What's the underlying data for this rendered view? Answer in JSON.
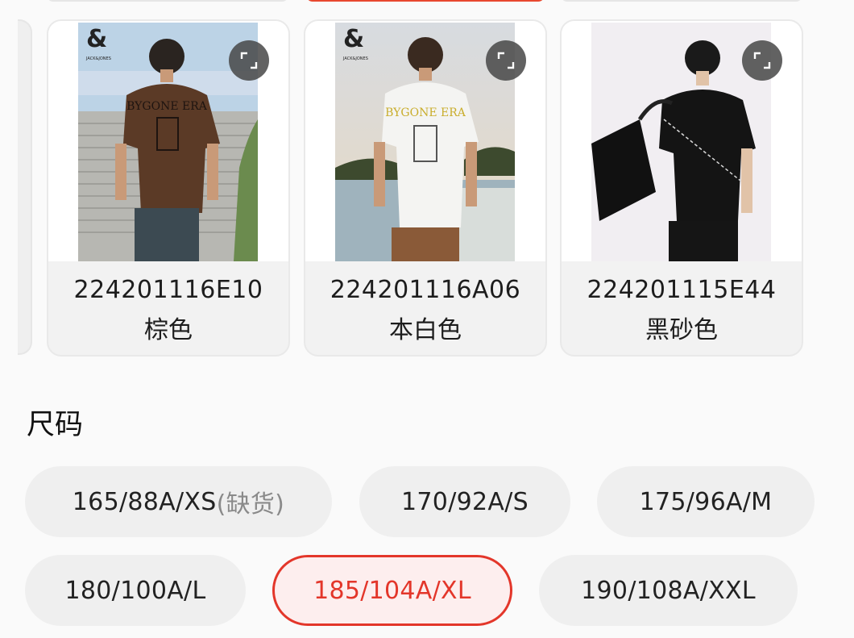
{
  "colors": [
    {
      "code": "224201116E10",
      "name": "棕色",
      "photo": "brown-tshirt-back"
    },
    {
      "code": "224201116A06",
      "name": "本白色",
      "photo": "white-tshirt-back"
    },
    {
      "code": "224201115E44",
      "name": "黑砂色",
      "photo": "black-tshirt-front"
    }
  ],
  "brand_mark": "&",
  "brand_text": "JACK&JONES",
  "graphic_text": "BYGONE ERA",
  "size_section": {
    "title": "尺码"
  },
  "sizes": [
    {
      "label": "165/88A/XS",
      "note": "(缺货)",
      "state": "out-of-stock"
    },
    {
      "label": "170/92A/S",
      "note": "",
      "state": "available"
    },
    {
      "label": "175/96A/M",
      "note": "",
      "state": "available"
    },
    {
      "label": "180/100A/L",
      "note": "",
      "state": "available"
    },
    {
      "label": "185/104A/XL",
      "note": "",
      "state": "selected"
    },
    {
      "label": "190/108A/XXL",
      "note": "",
      "state": "available"
    }
  ],
  "accent_color": "#e3362a"
}
